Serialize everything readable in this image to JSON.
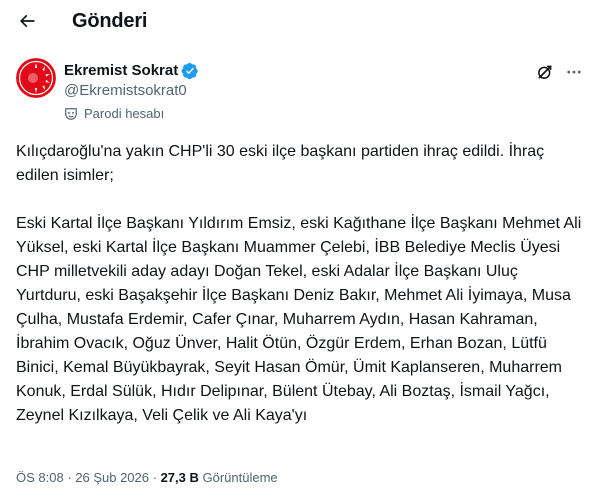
{
  "header": {
    "title": "Gönderi",
    "back_icon": "arrow-left-icon"
  },
  "author": {
    "display_name": "Ekremist Sokrat",
    "handle": "@Ekremistsokrat0",
    "verified_color": "#1d9bf0",
    "parody_label": "Parodi hesabı",
    "parody_icon": "mask-icon"
  },
  "actions": {
    "grok_icon": "grok-icon",
    "more_icon": "more-horizontal-icon"
  },
  "tweet": {
    "lines": [
      "Kılıçdaroğlu'na yakın CHP'li 30 eski ilçe başkanı partiden ihraç edildi. İhraç edilen isimler;",
      "Eski Kartal İlçe Başkanı Yıldırım Emsiz, eski Kağıthane İlçe Başkanı Mehmet Ali Yüksel, eski Kartal İlçe Başkanı Muammer Çelebi, İBB Belediye Meclis Üyesi CHP milletvekili aday adayı Doğan Tekel, eski Adalar İlçe Başkanı Uluç Yurtduru, eski Başakşehir İlçe Başkanı Deniz Bakır, Mehmet Ali İyimaya, Musa Çulha, Mustafa Erdemir, Cafer Çınar, Muharrem Aydın, Hasan Kahraman, İbrahim Ovacık, Oğuz Ünver, Halit Ötün, Özgür Erdem, Erhan Bozan, Lütfü Binici, Kemal Büyükbayrak, Seyit Hasan Ömür, Ümit Kaplanseren, Muharrem Konuk, Erdal Sülük, Hıdır Delipınar, Bülent Ütebay, Ali Boztaş, İsmail Yağcı, Zeynel Kızılkaya, Veli Çelik ve Ali Kaya'yı"
    ]
  },
  "meta": {
    "time": "ÖS 8:08",
    "separator": " · ",
    "date": "26 Şub 2026",
    "views_count": "27,3 B",
    "views_label": "Görüntüleme"
  }
}
